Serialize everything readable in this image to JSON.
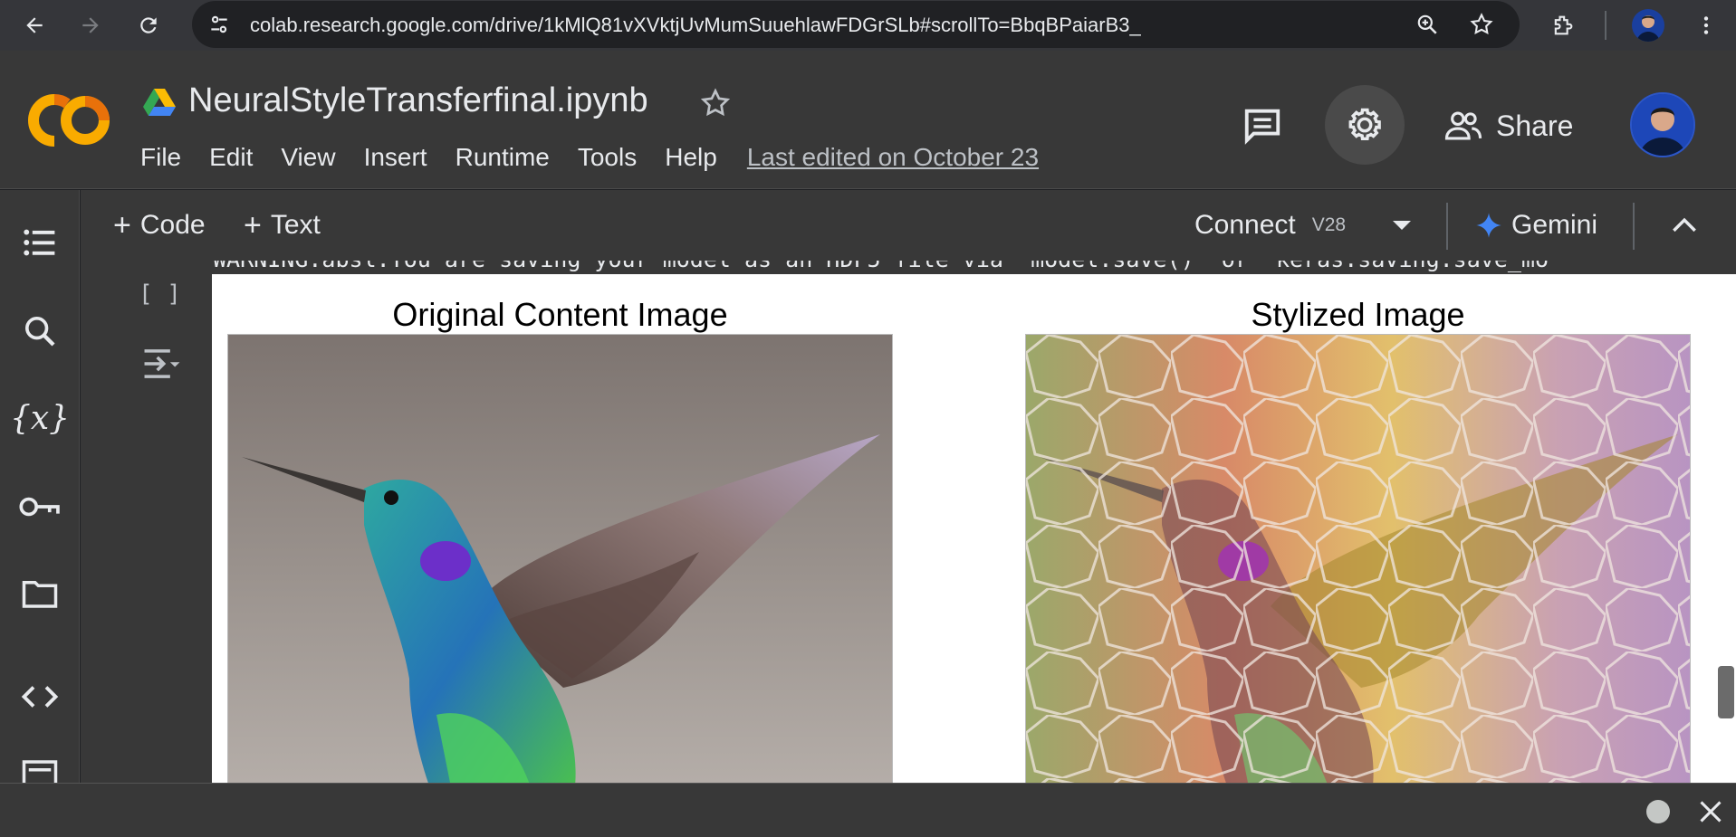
{
  "browser": {
    "url": "colab.research.google.com/drive/1kMlQ81vXVktjUvMumSuuehlawFDGrSLb#scrollTo=BbqBPaiarB3_",
    "icons": [
      "back-icon",
      "forward-icon",
      "reload-icon",
      "site-settings-icon",
      "zoom-icon",
      "bookmark-star-icon",
      "extensions-icon",
      "profile-avatar",
      "more-menu-icon"
    ]
  },
  "header": {
    "notebook_title": "NeuralStyleTransferfinal.ipynb",
    "menu": [
      "File",
      "Edit",
      "View",
      "Insert",
      "Runtime",
      "Tools",
      "Help"
    ],
    "last_edited": "Last edited on October 23",
    "share_label": "Share"
  },
  "toolbar": {
    "code_label": "Code",
    "text_label": "Text",
    "connect_label": "Connect",
    "runtime_label": "V28",
    "gemini_label": "Gemini"
  },
  "rail": {
    "icons": [
      "table-of-contents-icon",
      "search-icon",
      "variables-icon",
      "secrets-key-icon",
      "files-folder-icon",
      "code-snippets-icon",
      "terminal-icon"
    ]
  },
  "cell": {
    "execution_count": "[ ]",
    "warning_text": "WARNING:absl:You are saving your model as an HDF5 file via `model.save()` or `keras.saving.save_mo",
    "figure": {
      "left_title": "Original Content Image",
      "right_title": "Stylized Image"
    }
  },
  "colors": {
    "chrome": "#35363a",
    "colab_bg": "#383838",
    "accent_orange": "#f9ab00",
    "gemini_blue": "#4285f4"
  }
}
